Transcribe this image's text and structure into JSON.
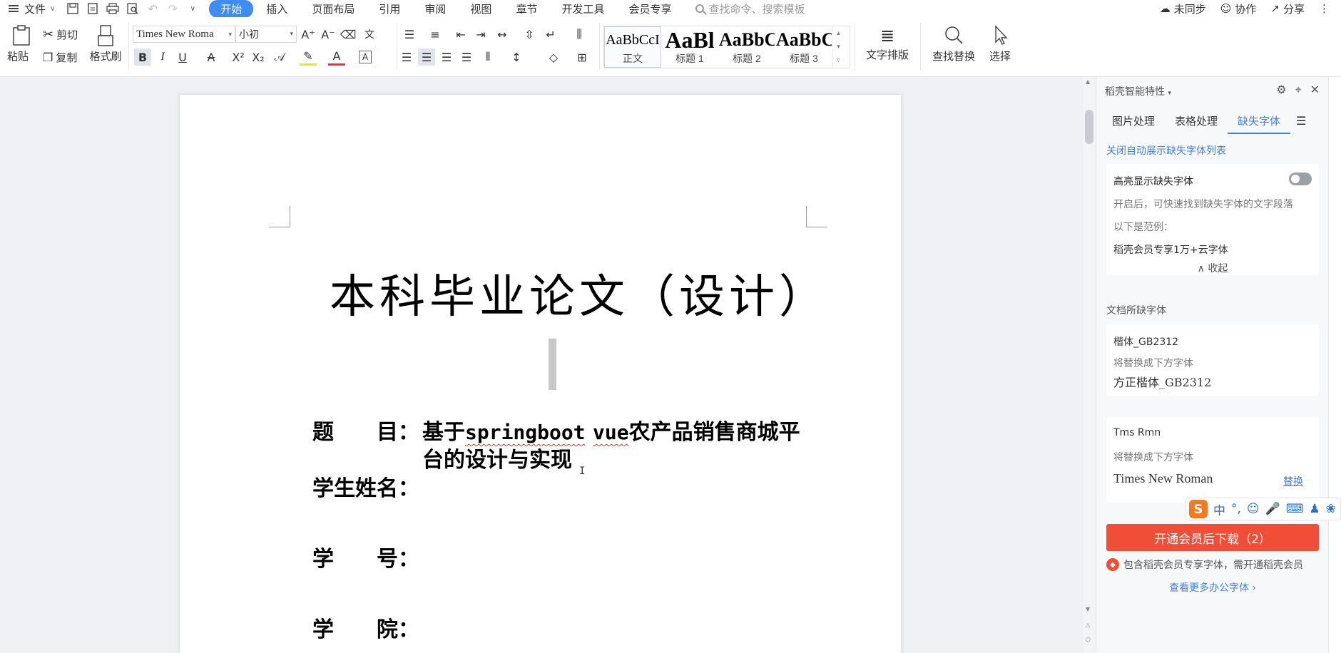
{
  "menubar": {
    "file_label": "文件",
    "tabs": [
      "开始",
      "插入",
      "页面布局",
      "引用",
      "审阅",
      "视图",
      "章节",
      "开发工具",
      "会员专享"
    ],
    "active_tab": "开始",
    "search_placeholder": "查找命令、搜索模板",
    "right": {
      "sync": "未同步",
      "collab": "协作",
      "share": "分享"
    }
  },
  "ribbon": {
    "paste": "粘贴",
    "cut": "剪切",
    "copy": "复制",
    "format_painter": "格式刷",
    "font_name": "Times New Roma",
    "font_size": "小初",
    "styles": [
      {
        "sample": "AaBbCcI",
        "name": "正文"
      },
      {
        "sample": "AaBl",
        "name": "标题 1"
      },
      {
        "sample": "AaBbC",
        "name": "标题 2"
      },
      {
        "sample": "AaBbC",
        "name": "标题 3"
      }
    ],
    "text_layout": "文字排版",
    "find_replace": "查找替换",
    "select": "选择"
  },
  "document": {
    "title": "本科毕业论文（设计）",
    "fields": {
      "topic_label": "题　　目：",
      "topic_line1": "基于",
      "topic_word1": "springboot",
      "topic_word2": "vue",
      "topic_line1_rest": "农产品销售商城平",
      "topic_line2": "台的设计与实现",
      "name_label": "学生姓名：",
      "id_label": "学　　号：",
      "college_label": "学　　院："
    }
  },
  "panel": {
    "header": "稻壳智能特性",
    "tabs": [
      "图片处理",
      "表格处理",
      "缺失字体"
    ],
    "active_tab": "缺失字体",
    "close_auto_link": "关闭自动展示缺失字体列表",
    "highlight_card": {
      "title": "高亮显示缺失字体",
      "desc": "开启后，可快速找到缺失字体的文字段落",
      "example_label": "以下是范例：",
      "example": "稻壳会员专享1万+云字体",
      "collapse": "收起"
    },
    "missing_label": "文档所缺字体",
    "missing_fonts": [
      {
        "name": "楷体_GB2312",
        "replace_hint": "将替换成下方字体",
        "replacement": "方正楷体_GB2312",
        "action": ""
      },
      {
        "name": "Tms Rmn",
        "replace_hint": "将替换成下方字体",
        "replacement": "Times New Roman",
        "action": "替换"
      }
    ],
    "cta": "开通会员后下载（2）",
    "note": "包含稻壳会员专享字体，需开通稻壳会员",
    "more_link": "查看更多办公字体 ›"
  },
  "ime": {
    "mode": "中",
    "punct": "°,"
  },
  "colors": {
    "accent": "#3f8cf5",
    "cta": "#f04e37",
    "link": "#3f7fe8"
  }
}
